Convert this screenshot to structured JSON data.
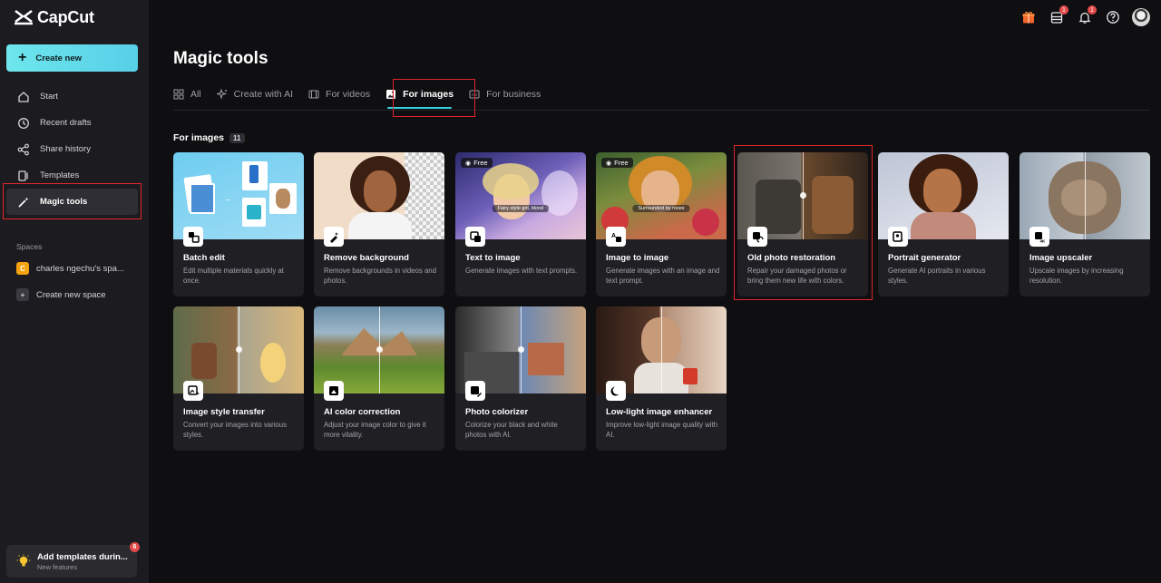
{
  "app": {
    "name": "CapCut"
  },
  "sidebar": {
    "create_label": "Create new",
    "items": [
      {
        "label": "Start",
        "icon": "home-icon"
      },
      {
        "label": "Recent drafts",
        "icon": "clock-icon"
      },
      {
        "label": "Share history",
        "icon": "share-icon"
      },
      {
        "label": "Templates",
        "icon": "templates-icon"
      },
      {
        "label": "Magic tools",
        "icon": "magic-wand-icon"
      }
    ],
    "spaces_label": "Spaces",
    "spaces": [
      {
        "label": "charles ngechu's spa...",
        "avatar": "C",
        "color": "#f4a30f"
      },
      {
        "label": "Create new space",
        "avatar": "+",
        "color": "#3a3a40"
      }
    ],
    "promo": {
      "title": "Add templates durin...",
      "subtitle": "New features",
      "badge": "6"
    }
  },
  "topbar": {
    "icons": [
      {
        "name": "gift-icon",
        "color": "#f0662b"
      },
      {
        "name": "inbox-icon",
        "badge": "1"
      },
      {
        "name": "bell-icon",
        "badge": "1"
      },
      {
        "name": "help-icon"
      },
      {
        "name": "user-avatar"
      }
    ]
  },
  "main": {
    "title": "Magic tools",
    "tabs": [
      {
        "label": "All",
        "icon": "grid-icon"
      },
      {
        "label": "Create with AI",
        "icon": "sparkle-icon"
      },
      {
        "label": "For videos",
        "icon": "film-icon"
      },
      {
        "label": "For images",
        "icon": "image-icon"
      },
      {
        "label": "For business",
        "icon": "ad-icon"
      }
    ],
    "active_tab": "For images",
    "section": {
      "title": "For images",
      "count": "11"
    },
    "cards": [
      {
        "title": "Batch edit",
        "desc": "Edit multiple materials quickly at once.",
        "icon": "batch-icon"
      },
      {
        "title": "Remove background",
        "desc": "Remove backgrounds in videos and photos.",
        "icon": "eraser-icon"
      },
      {
        "title": "Text to image",
        "desc": "Generate images with text prompts.",
        "icon": "text-image-icon",
        "tag": "Free",
        "caption": "Fairy style girl, blond"
      },
      {
        "title": "Image to image",
        "desc": "Generate images with an image and text prompt.",
        "icon": "image-to-image-icon",
        "tag": "Free",
        "caption": "Surrounded by roses"
      },
      {
        "title": "Old photo restoration",
        "desc": "Repair your damaged photos or bring them new life with colors.",
        "icon": "restore-icon"
      },
      {
        "title": "Portrait generator",
        "desc": "Generate AI portraits in various styles.",
        "icon": "portrait-icon"
      },
      {
        "title": "Image upscaler",
        "desc": "Upscale images by increasing resolution.",
        "icon": "upscale-icon"
      },
      {
        "title": "Image style transfer",
        "desc": "Convert your images into various styles.",
        "icon": "style-icon"
      },
      {
        "title": "AI color correction",
        "desc": "Adjust your image color to give it more vitality.",
        "icon": "color-correct-icon"
      },
      {
        "title": "Photo colorizer",
        "desc": "Colorize your black and white photos with AI.",
        "icon": "colorize-icon"
      },
      {
        "title": "Low-light image enhancer",
        "desc": "Improve low-light image quality with AI.",
        "icon": "moon-icon"
      }
    ]
  }
}
